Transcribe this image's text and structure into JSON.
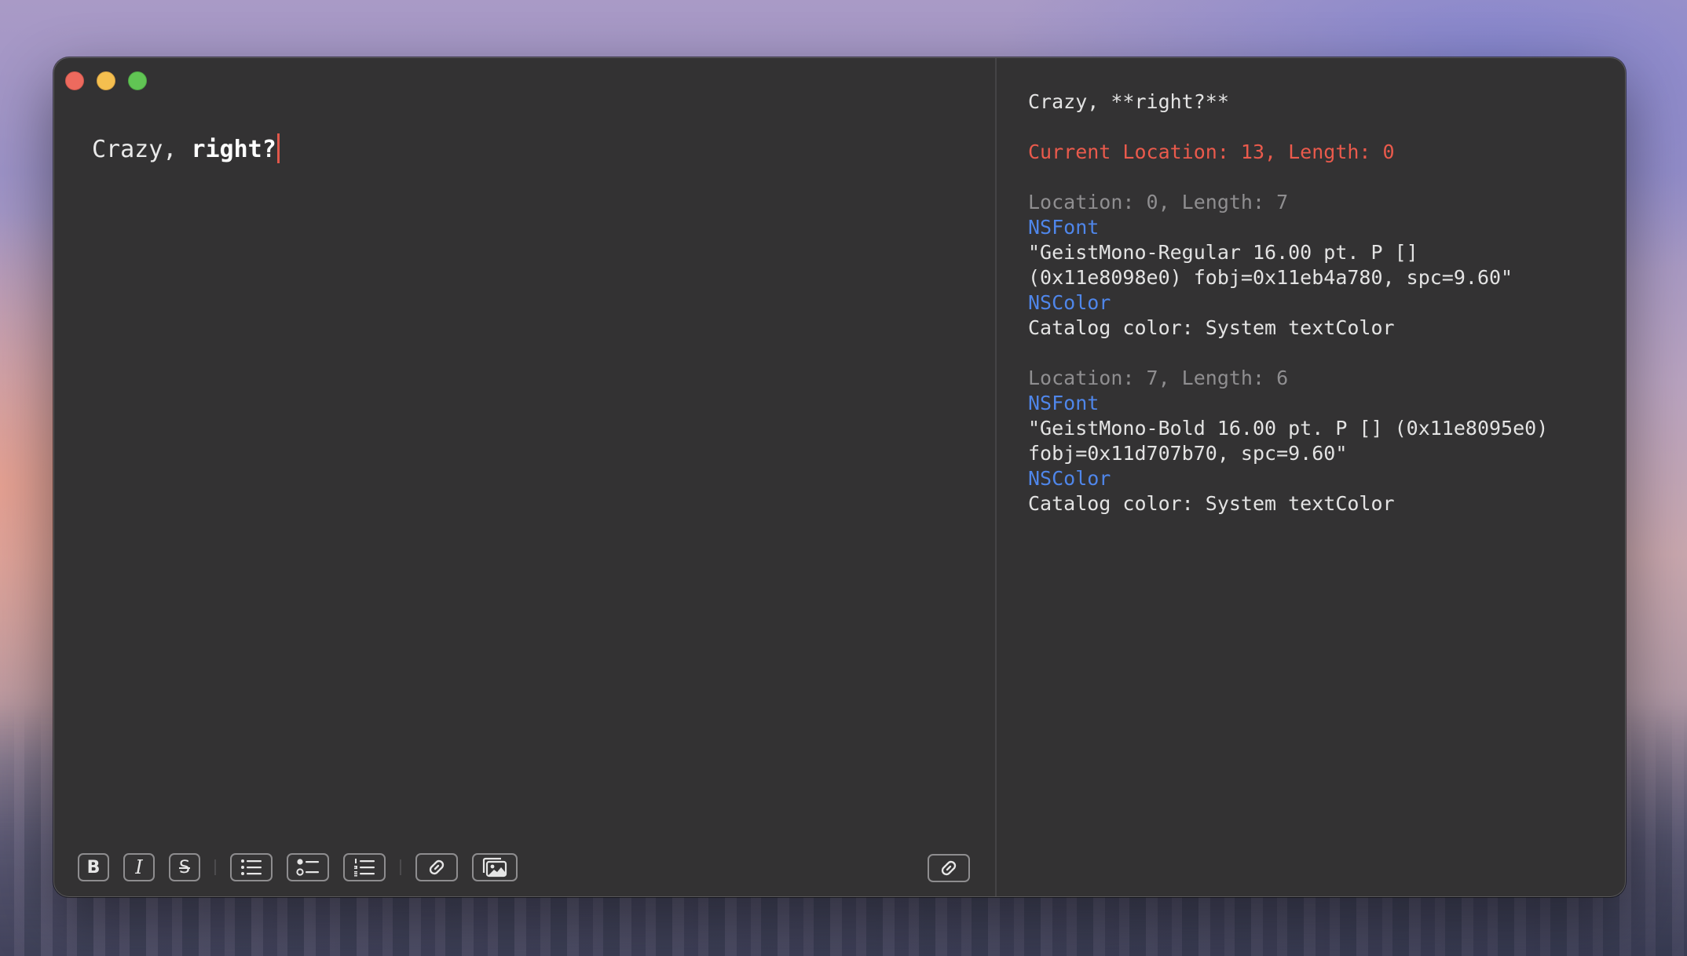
{
  "editor": {
    "text_regular": "Crazy, ",
    "text_bold": "right?"
  },
  "toolbar": {
    "bold_label": "B",
    "italic_label": "I",
    "strike_label": "S",
    "buttons": [
      "bold",
      "italic",
      "strikethrough",
      "bulleted-list",
      "checklist",
      "numbered-list",
      "link",
      "image"
    ],
    "right_button": "link"
  },
  "inspector": {
    "markdown": "Crazy, **right?**",
    "current": "Current Location: 13, Length: 0",
    "runs": [
      {
        "header": "Location: 0, Length: 7",
        "font_key": "NSFont",
        "font_line1": "\"GeistMono-Regular 16.00 pt. P []",
        "font_line2": "(0x11e8098e0) fobj=0x11eb4a780, spc=9.60\"",
        "color_key": "NSColor",
        "color_value": "Catalog color: System textColor"
      },
      {
        "header": "Location: 7, Length: 6",
        "font_key": "NSFont",
        "font_line1": "\"GeistMono-Bold 16.00 pt. P [] (0x11e8095e0)",
        "font_line2": "fobj=0x11d707b70, spc=9.60\"",
        "color_key": "NSColor",
        "color_value": "Catalog color: System textColor"
      }
    ]
  },
  "colors": {
    "window_bg": "#333233",
    "caret": "#e0574a",
    "current_location": "#ea5a4c",
    "attribute_key": "#4f86ea",
    "run_header": "#8f8e90"
  }
}
